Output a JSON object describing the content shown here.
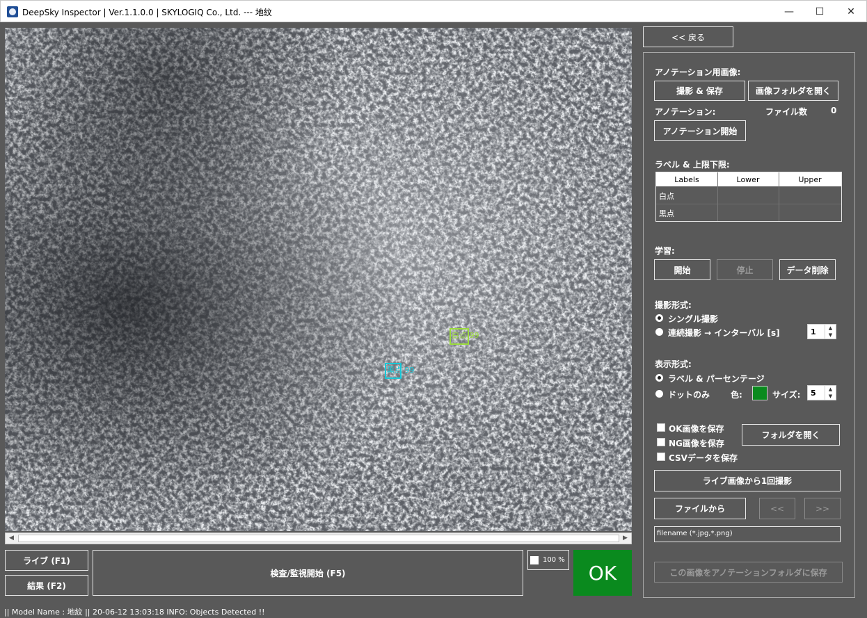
{
  "window": {
    "title": "DeepSky Inspector | Ver.1.1.0.0 | SKYLOGIQ Co., Ltd. --- 地紋",
    "minimize": "—",
    "maximize": "☐",
    "close": "✕"
  },
  "viewer": {
    "detections": [
      {
        "label": "白点 99",
        "color": "#9bdc3c"
      },
      {
        "label": "黒点 99",
        "color": "#18c8d8"
      }
    ]
  },
  "bottom": {
    "live_label": "ライブ (F1)",
    "result_label": "結果 (F2)",
    "inspect_label": "検査/監視開始 (F5)",
    "zoom_label": "100 %",
    "result_status": "OK"
  },
  "panel": {
    "back_label": "<< 戻る",
    "annotation_image_heading": "アノテーション用画像:",
    "capture_save_label": "撮影 & 保存",
    "open_image_folder_label": "画像フォルダを開く",
    "annotation_heading": "アノテーション:",
    "file_count_label": "ファイル数",
    "file_count_value": "0",
    "start_annotation_label": "アノテーション開始",
    "label_limits_heading": "ラベル & 上限下限:",
    "table": {
      "headers": [
        "Labels",
        "Lower",
        "Upper"
      ],
      "rows": [
        {
          "label": "白点",
          "lower": "",
          "upper": ""
        },
        {
          "label": "黒点",
          "lower": "",
          "upper": ""
        }
      ]
    },
    "learning_heading": "学習:",
    "learn_start_label": "開始",
    "learn_stop_label": "停止",
    "delete_data_label": "データ削除",
    "capture_mode_heading": "撮影形式:",
    "single_capture_label": "シングル撮影",
    "continuous_capture_label": "連続撮影 → インターバル [s]",
    "interval_value": "1",
    "display_mode_heading": "表示形式:",
    "label_percentage_label": "ラベル & パーセンテージ",
    "dots_only_label": "ドットのみ",
    "color_label": "色:",
    "dot_color": "#0a8a1e",
    "size_label": "サイズ:",
    "size_value": "5",
    "save_ok_label": "OK画像を保存",
    "save_ng_label": "NG画像を保存",
    "save_csv_label": "CSVデータを保存",
    "open_folder_label": "フォルダを開く",
    "capture_once_label": "ライブ画像から1回撮影",
    "from_file_label": "ファイルから",
    "prev_label": "<<",
    "next_label": ">>",
    "filename_placeholder": "filename (*.jpg,*.png)",
    "save_to_annotation_label": "この画像をアノテーションフォルダに保存"
  },
  "status": {
    "text": "|| Model Name : 地紋 ||    20-06-12 13:03:18   INFO:   Objects Detected !!"
  }
}
